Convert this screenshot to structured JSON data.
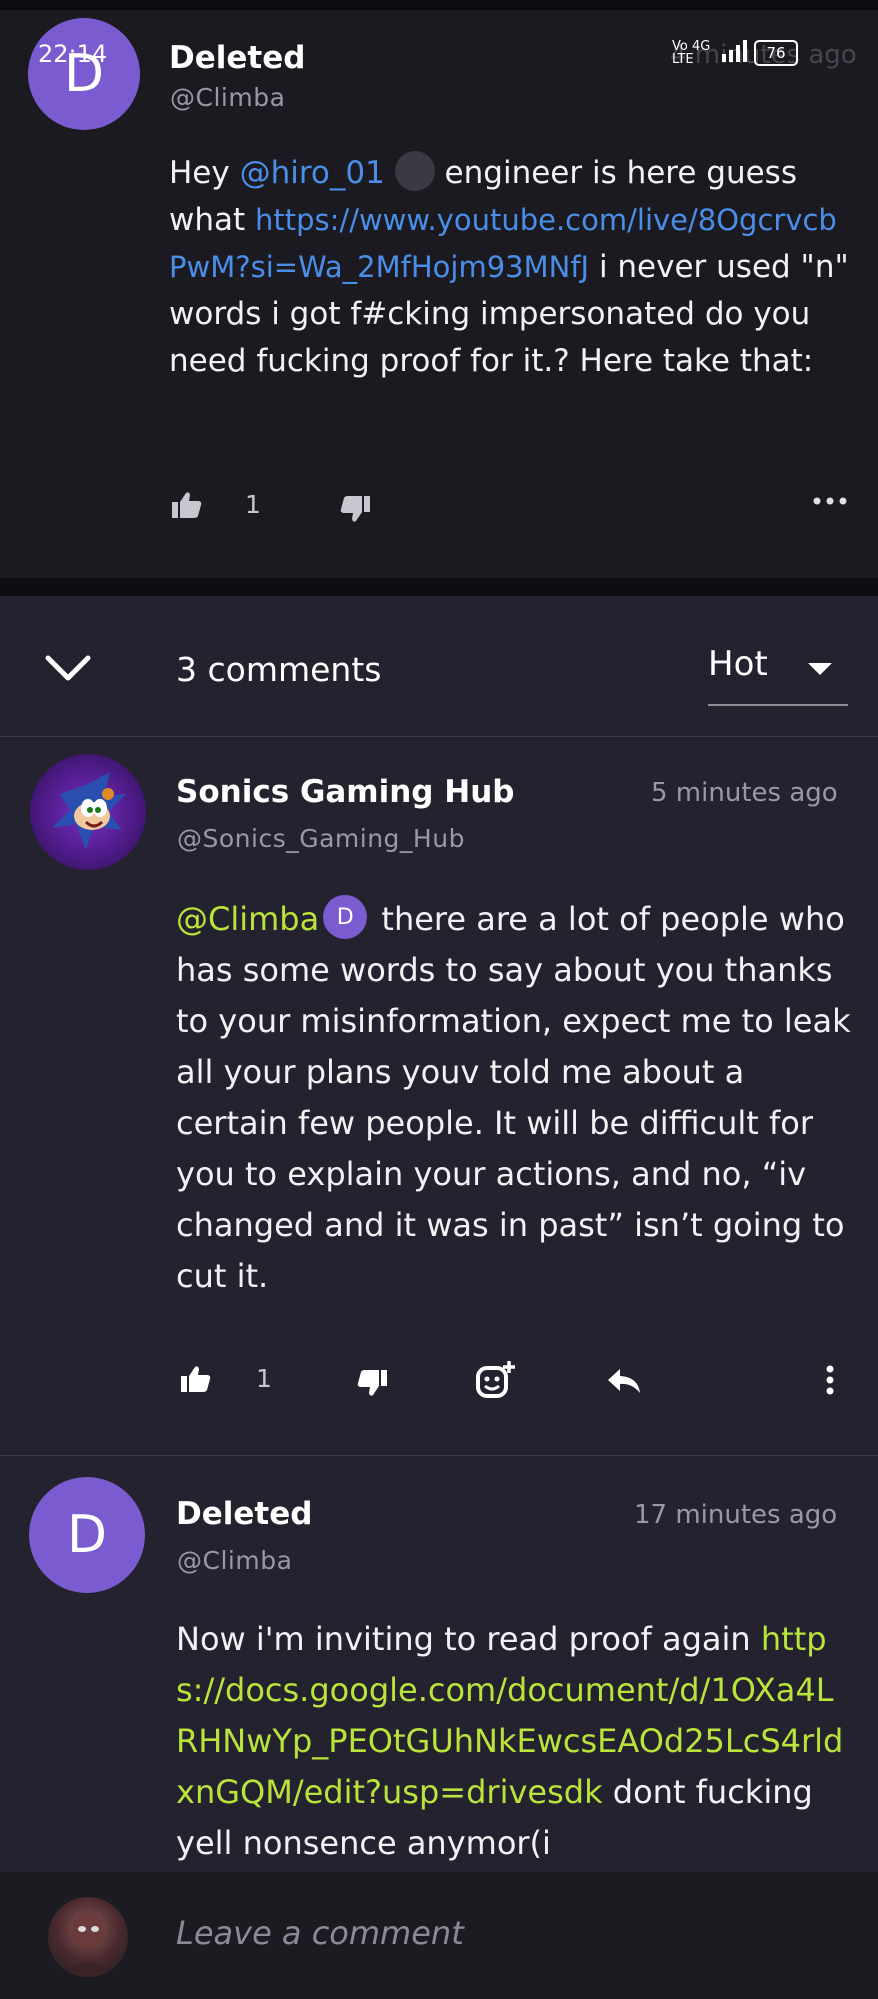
{
  "status_bar": {
    "time": "22:14",
    "network": "Vo 4G LTE",
    "battery": "76"
  },
  "post": {
    "avatar_letter": "D",
    "author": "Deleted",
    "handle": "@Climba",
    "time": "4 minutes ago",
    "text_parts": {
      "greeting": "Hey ",
      "mention": "@hiro_01",
      "after_mention": " engineer is here guess what ",
      "link": "https://www.youtube.com/live/8OgcrvcbPwM?si=Wa_2MfHojm93MNfJ",
      "rest": " i never used \"n\" words i got f#cking impersonated do you need fucking proof for it.? Here take that:"
    },
    "likes": "1",
    "more_icon": "more-horizontal-icon"
  },
  "comments_header": {
    "count_label": "3 comments",
    "sort_label": "Hot"
  },
  "comments": [
    {
      "author": "Sonics Gaming Hub",
      "handle": "@Sonics_Gaming_Hub",
      "time": "5 minutes ago",
      "mention": "@Climba",
      "mention_badge": "D",
      "text": " there are a lot of people who has some words to say about you thanks to your misinformation, expect me to leak all your plans youv told me about a certain few people. It will be difficult for you to explain your actions, and no, “iv changed and it was in past” isn’t going to cut it.",
      "likes": "1"
    },
    {
      "avatar_letter": "D",
      "author": "Deleted",
      "handle": "@Climba",
      "time": "17 minutes ago",
      "text_start": "Now i'm inviting to read proof again ",
      "link": "https://docs.google.com/document/d/1OXa4LRHNwYp_PEOtGUhNkEwcsEAOd25LcS4rldxnGQM/edit?usp=drivesdk",
      "text_end": " dont fucking yell nonsence anymor(i"
    }
  ],
  "composer": {
    "placeholder": "Leave a comment"
  },
  "colors": {
    "background": "#24222f",
    "top_card": "#1b1a21",
    "avatar_purple": "#7b5bd0",
    "link_blue": "#4a8ee8",
    "link_green": "#b9e43a"
  }
}
